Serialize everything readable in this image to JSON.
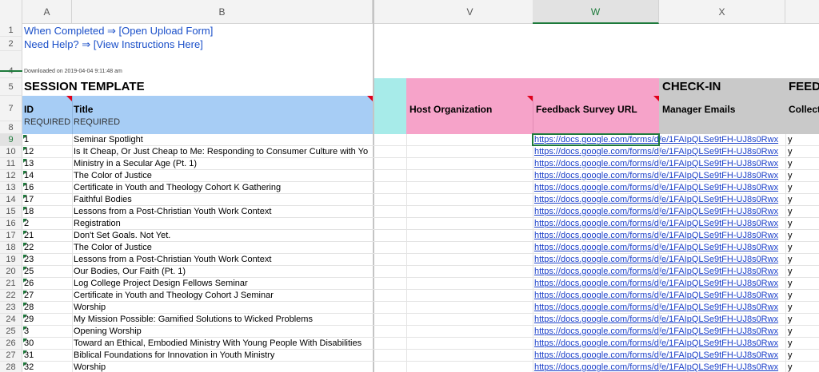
{
  "columns": {
    "left": [
      "A",
      "B"
    ],
    "right": [
      "V",
      "W",
      "X"
    ],
    "selected": "W"
  },
  "header_rows": [
    "1",
    "2",
    "4",
    "5",
    "7",
    "8"
  ],
  "links": {
    "upload": "When Completed ⇒ [Open Upload Form]",
    "help": "Need Help? ⇒ [View Instructions Here]"
  },
  "downloaded": "Downloaded on 2019-04-04 9:11:48 am",
  "section_titles": {
    "session_template": "SESSION TEMPLATE",
    "check_in": "CHECK-IN",
    "feed": "FEED"
  },
  "headers": {
    "id": "ID",
    "id_required": "REQUIRED",
    "title": "Title",
    "title_required": "REQUIRED",
    "host_org": "Host Organization",
    "feedback_url": "Feedback Survey URL",
    "manager_emails": "Manager Emails",
    "collect": "Collect"
  },
  "colors": {
    "accent_green": "#1d7a3b",
    "header_blue": "#a7cdf5",
    "header_cyan": "#a7ebe9",
    "header_pink": "#f6a3c9",
    "header_gray": "#c9c9c9",
    "link_blue": "#1a4fc9"
  },
  "url_text": "https://docs.google.com/forms/d/e/1FAIpQLSe9tFH-UJ8s0Rwx",
  "rows": [
    {
      "row": "9",
      "id": "1",
      "title": "Seminar Spotlight",
      "x": "y"
    },
    {
      "row": "10",
      "id": "12",
      "title": "Is It Cheap, Or Just Cheap to Me: Responding to Consumer Culture with Yo",
      "x": "y"
    },
    {
      "row": "11",
      "id": "13",
      "title": "Ministry in a Secular Age (Pt. 1)",
      "x": "y"
    },
    {
      "row": "12",
      "id": "14",
      "title": "The Color of Justice",
      "x": "y"
    },
    {
      "row": "13",
      "id": "16",
      "title": "Certificate in Youth and Theology Cohort K Gathering",
      "x": "y"
    },
    {
      "row": "14",
      "id": "17",
      "title": "Faithful Bodies",
      "x": "y"
    },
    {
      "row": "15",
      "id": "18",
      "title": "Lessons from a Post-Christian Youth Work Context",
      "x": "y"
    },
    {
      "row": "16",
      "id": "2",
      "title": "Registration",
      "x": "y"
    },
    {
      "row": "17",
      "id": "21",
      "title": "Don't Set Goals. Not Yet.",
      "x": "y"
    },
    {
      "row": "18",
      "id": "22",
      "title": "The Color of Justice",
      "x": "y"
    },
    {
      "row": "19",
      "id": "23",
      "title": "Lessons from a Post-Christian Youth Work Context",
      "x": "y"
    },
    {
      "row": "20",
      "id": "25",
      "title": "Our Bodies, Our Faith (Pt. 1)",
      "x": "y"
    },
    {
      "row": "21",
      "id": "26",
      "title": "Log College Project Design Fellows Seminar",
      "x": "y"
    },
    {
      "row": "22",
      "id": "27",
      "title": "Certificate in Youth and Theology Cohort J Seminar",
      "x": "y"
    },
    {
      "row": "23",
      "id": "28",
      "title": "Worship",
      "x": "y"
    },
    {
      "row": "24",
      "id": "29",
      "title": "My Mission Possible: Gamified Solutions to Wicked Problems",
      "x": "y"
    },
    {
      "row": "25",
      "id": "3",
      "title": "Opening Worship",
      "x": "y"
    },
    {
      "row": "26",
      "id": "30",
      "title": "Toward an Ethical, Embodied Ministry With Young People With Disabilities",
      "x": "y"
    },
    {
      "row": "27",
      "id": "31",
      "title": "Biblical Foundations for Innovation in Youth Ministry",
      "x": "y"
    },
    {
      "row": "28",
      "id": "32",
      "title": "Worship",
      "x": "y"
    }
  ]
}
